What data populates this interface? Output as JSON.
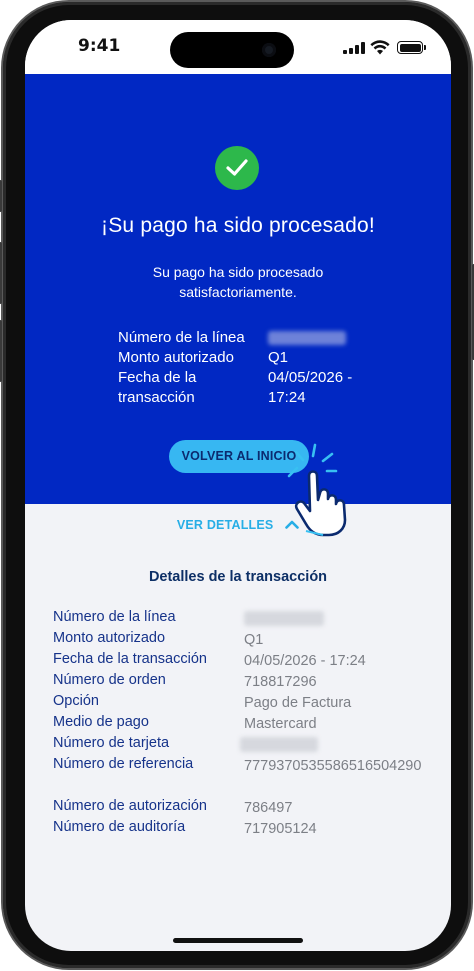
{
  "status_bar": {
    "time": "9:41"
  },
  "hero": {
    "title": "¡Su pago ha sido procesado!",
    "subtitle": "Su pago ha sido procesado satisfactoriamente.",
    "rows": [
      {
        "label": "Número de la línea",
        "value": "",
        "redacted": true
      },
      {
        "label": "Monto autorizado",
        "value": "Q1"
      },
      {
        "label": "Fecha de la transacción",
        "value": "04/05/2026 - 17:24"
      }
    ],
    "home_button": "VOLVER AL INICIO"
  },
  "details_toggle": "VER DETALLES",
  "details": {
    "title": "Detalles de la transacción",
    "rows": [
      {
        "label": "Número de la línea",
        "value": "",
        "redacted": true
      },
      {
        "label": "Monto autorizado",
        "value": "Q1"
      },
      {
        "label": "Fecha de la transacción",
        "value": "04/05/2026 - 17:24"
      },
      {
        "label": "Número de orden",
        "value": "718817296"
      },
      {
        "label": "Opción",
        "value": "Pago de Factura"
      },
      {
        "label": "Medio de pago",
        "value": "Mastercard"
      },
      {
        "label": "Número de tarjeta",
        "value": "",
        "redacted": true
      },
      {
        "label": "Número de referencia",
        "value": "7779370535586516504290"
      },
      {
        "label": "Número de autorización",
        "value": "786497"
      },
      {
        "label": "Número de auditoría",
        "value": "717905124"
      }
    ]
  },
  "colors": {
    "hero_bg": "#0128c3",
    "success_green": "#2db84b",
    "button_bg": "#37b7f2",
    "toggle_text": "#27aee6",
    "label_text": "#16338a",
    "value_text": "#7c7f86"
  },
  "icons": [
    "check-circle-icon",
    "chevron-up-icon",
    "tap-hand-icon"
  ]
}
